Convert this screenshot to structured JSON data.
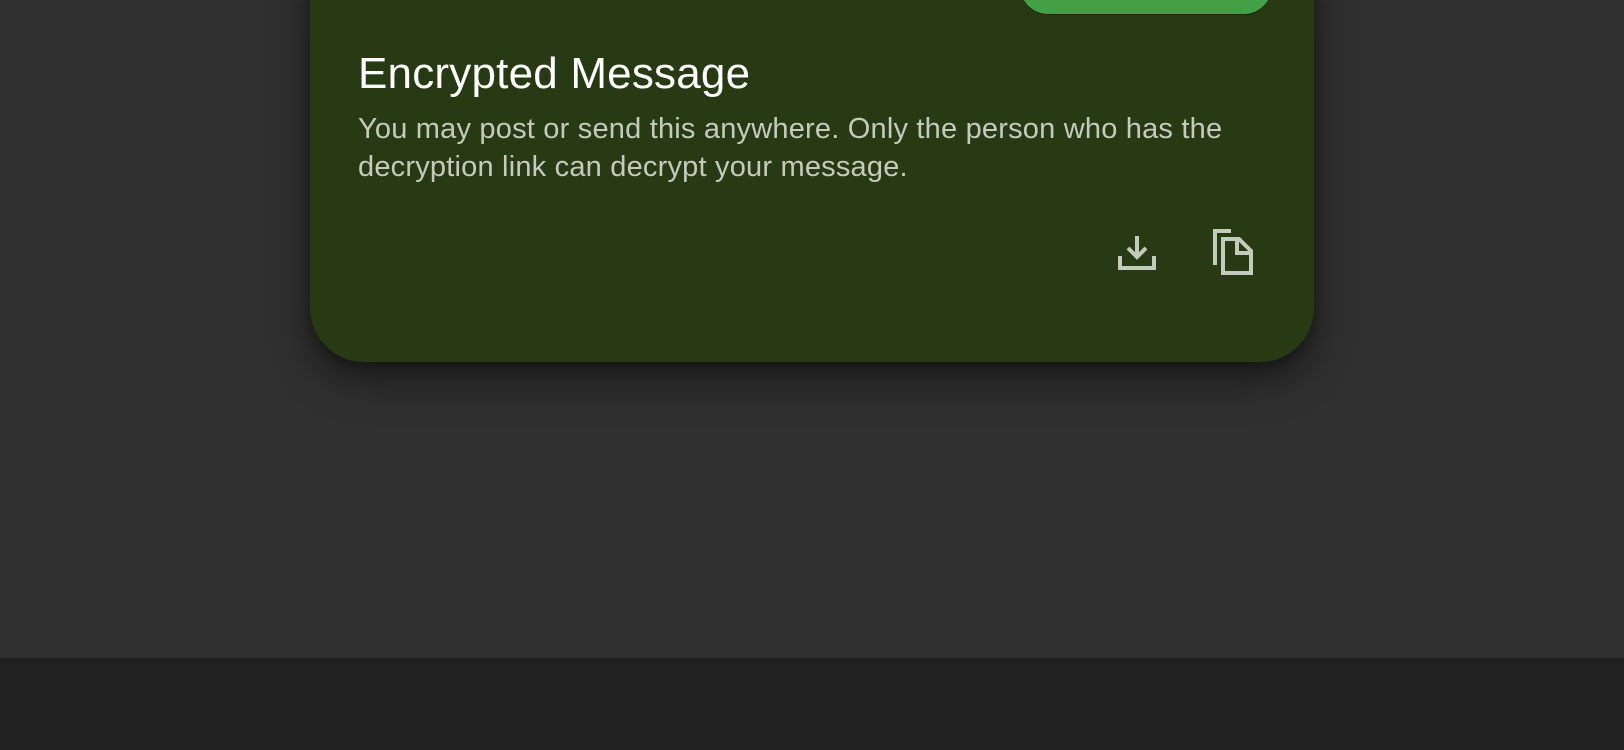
{
  "card": {
    "title": "Encrypted Message",
    "description": "You may post or send this anywhere. Only the person who has the decryption link can decrypt your message."
  },
  "actions": [
    {
      "icon": "download-icon"
    },
    {
      "icon": "copy-icon"
    }
  ],
  "colors": {
    "background": "#303030",
    "card": "#283a14",
    "accent": "#43a047",
    "bottom_bar": "#212121",
    "icon": "#c3cbbd"
  }
}
